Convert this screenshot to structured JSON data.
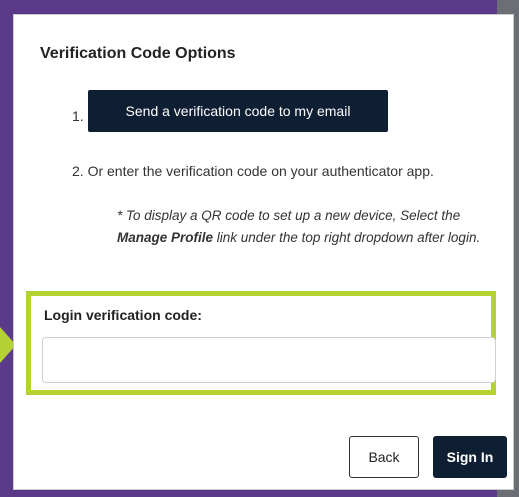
{
  "dialog": {
    "title": "Verification Code Options",
    "step1_number": "1.",
    "send_code_label": "Send a verification code to my email",
    "step2_text": "2. Or enter the verification code on your authenticator app.",
    "note_prefix": "* To display a QR code to set up a new device, Select the ",
    "note_link": "Manage Profile",
    "note_suffix": " link under the top right dropdown after login.",
    "code_label": "Login verification code:",
    "code_value": "",
    "back_label": "Back",
    "signin_label": "Sign In"
  },
  "colors": {
    "frame": "#5b3b89",
    "highlight": "#b4d234",
    "primary_button": "#0f1f33"
  }
}
